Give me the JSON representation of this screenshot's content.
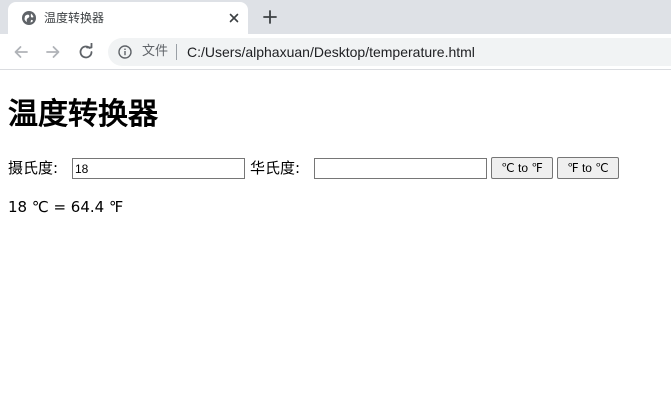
{
  "browser": {
    "tab": {
      "title": "温度转换器",
      "favicon": "globe-icon"
    },
    "toolbar": {
      "security_chip": "文件",
      "url": "C:/Users/alphaxuan/Desktop/temperature.html"
    }
  },
  "page": {
    "title": "温度转换器",
    "celsius_label": "摄氏度:",
    "celsius_value": "18",
    "fahrenheit_label": "华氏度:",
    "fahrenheit_value": "",
    "c_to_f_button": "℃ to ℉",
    "f_to_c_button": "℉ to ℃",
    "result": "18 ℃ = 64.4 ℉"
  },
  "colors": {
    "tabstrip_bg": "#dee1e6",
    "omnibox_bg": "#f1f3f4",
    "icon_gray": "#5f6368"
  }
}
